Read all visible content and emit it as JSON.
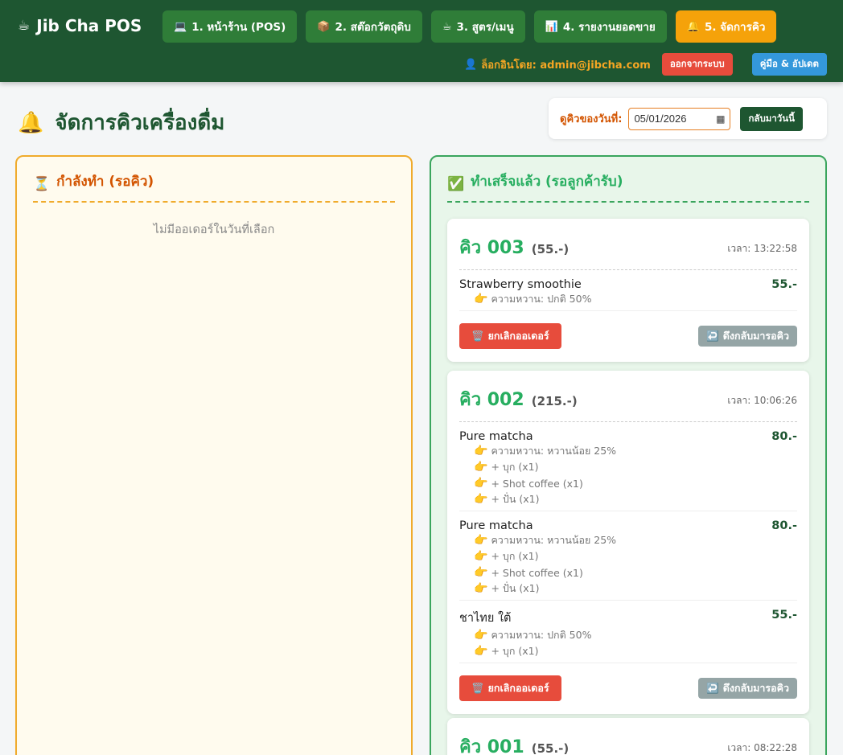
{
  "app": {
    "brand": "Jib Cha POS",
    "brand_icon": "☕"
  },
  "nav": [
    {
      "label": "1. หน้าร้าน (POS)",
      "icon": "💻",
      "active": false
    },
    {
      "label": "2. สต๊อกวัตถุดิบ",
      "icon": "📦",
      "active": false
    },
    {
      "label": "3. สูตร/เมนู",
      "icon": "☕",
      "active": false
    },
    {
      "label": "4. รายงานยอดขาย",
      "icon": "📊",
      "active": false
    },
    {
      "label": "5. จัดการคิว",
      "icon": "🔔",
      "active": true
    }
  ],
  "user": {
    "icon": "👤",
    "label": "ล็อกอินโดย: admin@jibcha.com",
    "logout": "ออกจากระบบ",
    "manual": "คู่มือ & อัปเดต"
  },
  "page": {
    "icon": "🔔",
    "title": "จัดการคิวเครื่องดื่ม"
  },
  "date_filter": {
    "label": "ดูคิวของวันที่:",
    "value": "05/01/2026",
    "today_btn": "กลับมาวันนี้"
  },
  "pending": {
    "icon": "⏳",
    "title": "กำลังทำ (รอคิว)",
    "empty": "ไม่มีออเดอร์ในวันที่เลือก"
  },
  "done": {
    "icon": "✅",
    "title": "ทำเสร็จแล้ว (รอลูกค้ารับ)"
  },
  "labels": {
    "cancel": "ยกเลิกออเดอร์",
    "recall": "ดึงกลับมารอคิว",
    "cancel_icon": "🗑️",
    "recall_icon": "↩️",
    "option_icon": "👉"
  },
  "orders": [
    {
      "queue": "คิว 003",
      "total": "(55.-)",
      "time": "เวลา: 13:22:58",
      "items": [
        {
          "name": "Strawberry smoothie",
          "price": "55.-",
          "options": [
            "ความหวาน: ปกติ 50%"
          ]
        }
      ]
    },
    {
      "queue": "คิว 002",
      "total": "(215.-)",
      "time": "เวลา: 10:06:26",
      "items": [
        {
          "name": "Pure matcha",
          "price": "80.-",
          "options": [
            "ความหวาน: หวานน้อย 25%",
            "+ บุก (x1)",
            "+ Shot coffee (x1)",
            "+ ปั่น (x1)"
          ]
        },
        {
          "name": "Pure matcha",
          "price": "80.-",
          "options": [
            "ความหวาน: หวานน้อย 25%",
            "+ บุก (x1)",
            "+ Shot coffee (x1)",
            "+ ปั่น (x1)"
          ]
        },
        {
          "name": "ชาไทย ใต้",
          "price": "55.-",
          "options": [
            "ความหวาน: ปกติ 50%",
            "+ บุก (x1)"
          ]
        }
      ]
    },
    {
      "queue": "คิว 001",
      "total": "(55.-)",
      "time": "เวลา: 08:22:28",
      "items": []
    }
  ]
}
